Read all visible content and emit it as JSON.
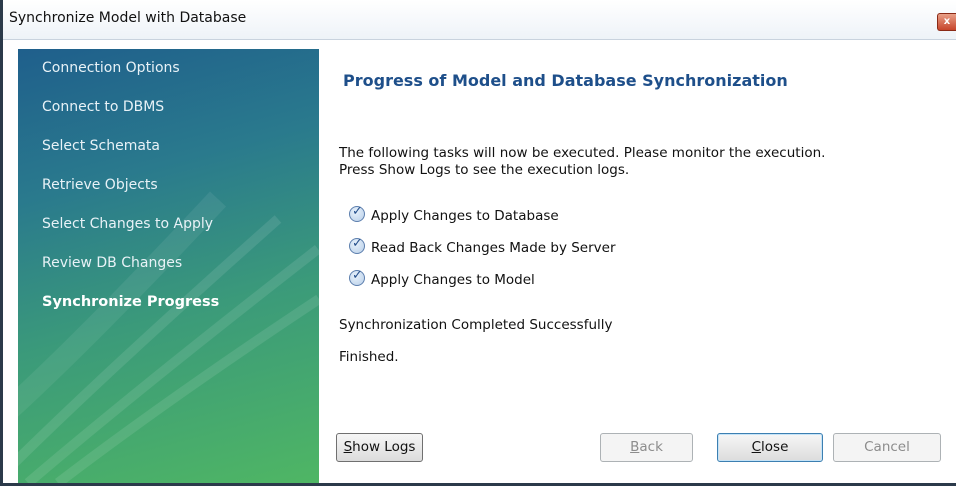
{
  "window": {
    "title": "Synchronize Model with Database",
    "close_glyph": "x"
  },
  "sidebar": {
    "items": [
      {
        "label": "Connection Options",
        "active": false
      },
      {
        "label": "Connect to DBMS",
        "active": false
      },
      {
        "label": "Select Schemata",
        "active": false
      },
      {
        "label": "Retrieve Objects",
        "active": false
      },
      {
        "label": "Select Changes to Apply",
        "active": false
      },
      {
        "label": "Review DB Changes",
        "active": false
      },
      {
        "label": "Synchronize Progress",
        "active": true
      }
    ]
  },
  "main": {
    "heading": "Progress of Model and Database Synchronization",
    "description_line1": "The following tasks will now be executed. Please monitor the execution.",
    "description_line2": "Press Show Logs to see the execution logs.",
    "tasks": [
      {
        "label": "Apply Changes to Database",
        "icon": "check-circle-icon",
        "done": true
      },
      {
        "label": "Read Back Changes Made by Server",
        "icon": "check-circle-icon",
        "done": true
      },
      {
        "label": "Apply Changes to Model",
        "icon": "check-circle-icon",
        "done": true
      }
    ],
    "status_message": "Synchronization Completed Successfully",
    "finished_message": "Finished."
  },
  "buttons": {
    "show_logs": {
      "access_key": "S",
      "rest": "how Logs"
    },
    "back": {
      "access_key": "B",
      "rest": "ack",
      "enabled": false
    },
    "close": {
      "access_key": "C",
      "rest": "lose",
      "enabled": true
    },
    "cancel": {
      "label": "Cancel",
      "enabled": false
    }
  },
  "colors": {
    "heading": "#1e4f8a",
    "sidebar_top": "#1f5f8c",
    "sidebar_bottom": "#4fb664"
  }
}
